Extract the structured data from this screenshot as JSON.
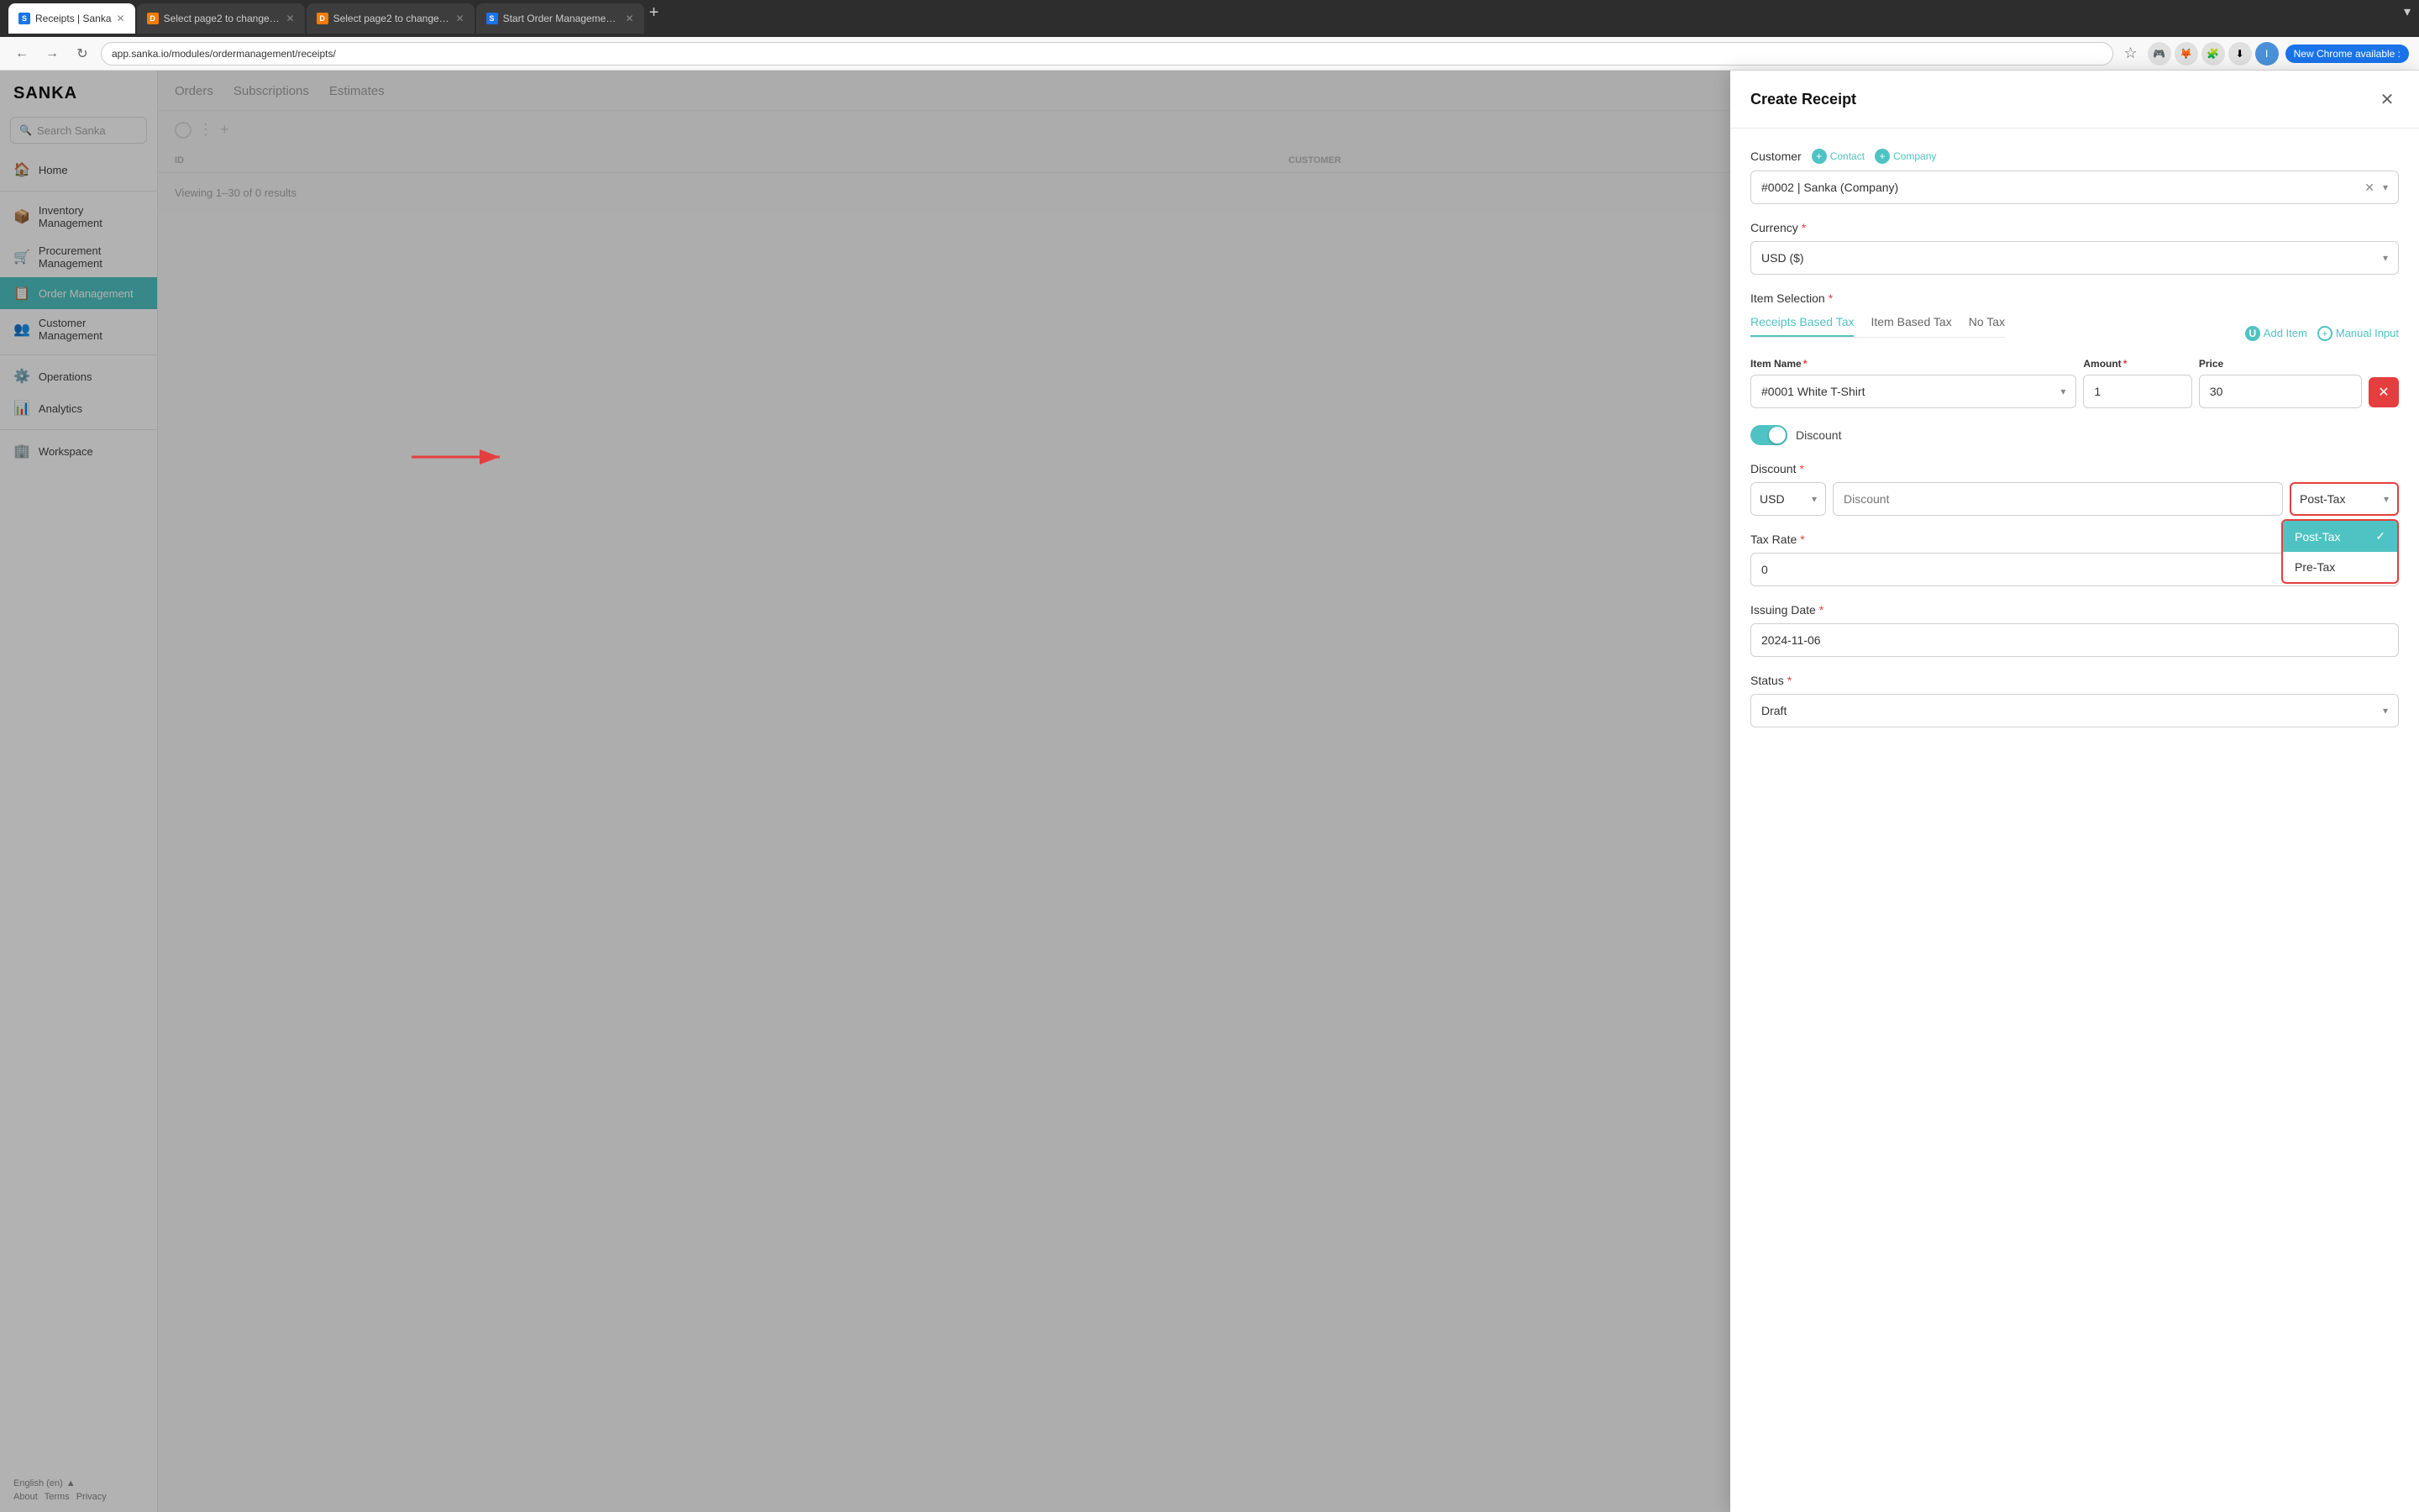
{
  "browser": {
    "tabs": [
      {
        "id": "tab1",
        "favicon": "S",
        "title": "Receipts | Sanka",
        "active": true
      },
      {
        "id": "tab2",
        "favicon": "D",
        "title": "Select page2 to change | Dja...",
        "active": false
      },
      {
        "id": "tab3",
        "favicon": "D",
        "title": "Select page2 to change | Dja...",
        "active": false
      },
      {
        "id": "tab4",
        "favicon": "S",
        "title": "Start Order Management with...",
        "active": false
      }
    ],
    "address": "app.sanka.io/modules/ordermanagement/receipts/",
    "chrome_available": "New Chrome available  :"
  },
  "sidebar": {
    "logo": "SANKA",
    "search_placeholder": "Search Sanka",
    "nav_items": [
      {
        "id": "home",
        "icon": "🏠",
        "label": "Home"
      },
      {
        "id": "inventory",
        "icon": "📦",
        "label": "Inventory Management"
      },
      {
        "id": "procurement",
        "icon": "🛒",
        "label": "Procurement Management"
      },
      {
        "id": "order",
        "icon": "📋",
        "label": "Order Management",
        "active": true
      },
      {
        "id": "customer",
        "icon": "👥",
        "label": "Customer Management"
      },
      {
        "id": "operations",
        "icon": "⚙️",
        "label": "Operations"
      },
      {
        "id": "analytics",
        "icon": "📊",
        "label": "Analytics"
      },
      {
        "id": "workspace",
        "icon": "🏢",
        "label": "Workspace"
      }
    ],
    "footer": {
      "language": "English (en)",
      "links": [
        "About",
        "Terms",
        "Privacy"
      ]
    }
  },
  "main": {
    "tabs": [
      "Orders",
      "Subscriptions",
      "Estimates"
    ],
    "table_headers": [
      "ID",
      "CUSTOMER"
    ],
    "viewing_text": "Viewing 1–30 of 0 results"
  },
  "modal": {
    "title": "Create Receipt",
    "customer": {
      "label": "Customer",
      "add_contact": "Contact",
      "add_company": "Company",
      "value": "#0002 | Sanka (Company)"
    },
    "currency": {
      "label": "Currency",
      "required": true,
      "value": "USD ($)"
    },
    "item_selection": {
      "label": "Item Selection",
      "required": true,
      "tax_tabs": [
        "Receipts Based Tax",
        "Item Based Tax",
        "No Tax"
      ],
      "active_tab": "Receipts Based Tax",
      "add_item_label": "Add Item",
      "manual_input_label": "Manual Input"
    },
    "item_row": {
      "item_name_label": "Item Name",
      "amount_label": "Amount",
      "price_label": "Price",
      "item_value": "#0001 White T-Shirt",
      "amount_value": "1",
      "price_value": "30"
    },
    "discount_toggle": {
      "label": "Discount",
      "enabled": true
    },
    "discount": {
      "label": "Discount",
      "required": true,
      "currency_value": "USD",
      "input_placeholder": "Discount",
      "type_value": "Post-Tax",
      "options": [
        {
          "label": "Post-Tax",
          "selected": true
        },
        {
          "label": "Pre-Tax",
          "selected": false
        }
      ]
    },
    "tax_rate": {
      "label": "Tax Rate",
      "required": true,
      "value": "0"
    },
    "issuing_date": {
      "label": "Issuing Date",
      "required": true,
      "value": "2024-11-06"
    },
    "status": {
      "label": "Status",
      "required": true,
      "value": "Draft"
    }
  }
}
